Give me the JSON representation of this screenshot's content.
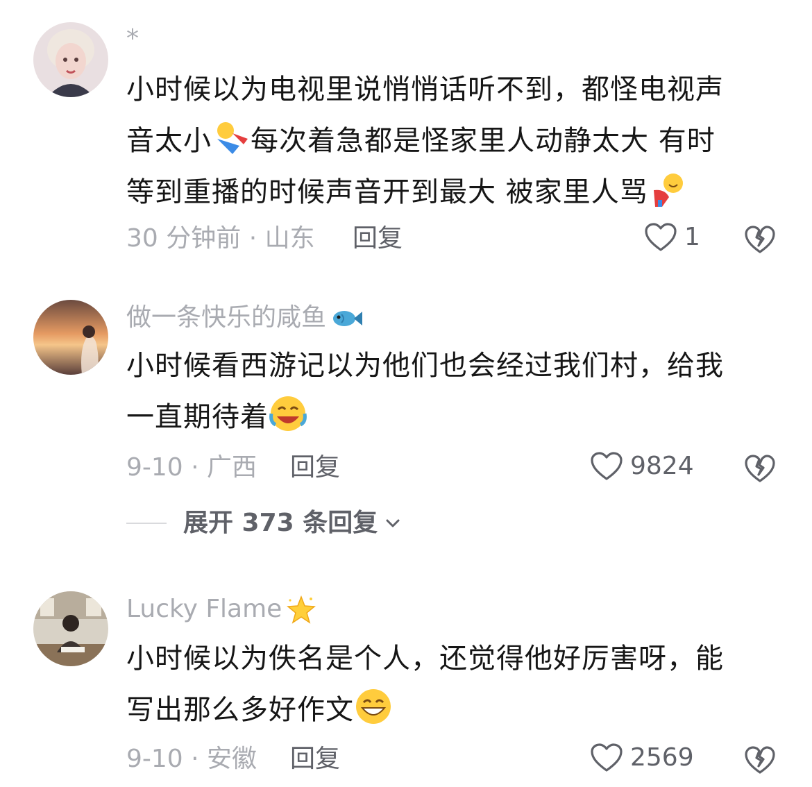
{
  "comments": [
    {
      "username": "*",
      "text_lines": [
        "小时候以为电视里说悄悄话听不到，都怪电视声",
        "音太小",
        "每次着急都是怪家里人动静太大 有时",
        "等到重播的时候声音开到最大 被家里人骂"
      ],
      "time_location": "30 分钟前 · 山东",
      "reply_label": "回复",
      "likes": "1"
    },
    {
      "username": "做一条快乐的咸鱼",
      "text_lines": [
        "小时候看西游记以为他们也会经过我们村，给我",
        "一直期待着"
      ],
      "time_location": "9-10 · 广西",
      "reply_label": "回复",
      "likes": "9824",
      "expand_label": "展开 373 条回复"
    },
    {
      "username": "Lucky Flame",
      "text_lines": [
        "小时候以为佚名是个人，还觉得他好厉害呀，能",
        "写出那么多好作文"
      ],
      "time_location": "9-10 · 安徽",
      "reply_label": "回复",
      "likes": "2569"
    }
  ],
  "icons": {
    "like": "heart-outline-icon",
    "dislike": "broken-heart-icon",
    "expand": "chevron-down-icon",
    "username_emoji_2": "fish-icon",
    "username_emoji_3": "star-icon"
  },
  "colors": {
    "muted": "#a9abb1",
    "action": "#5f6168",
    "text": "#161616"
  }
}
